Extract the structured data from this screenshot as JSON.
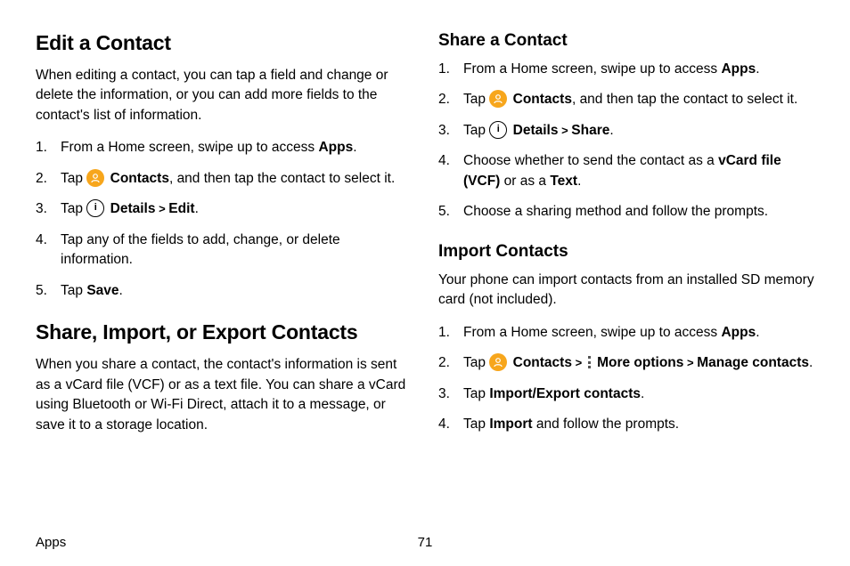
{
  "left": {
    "h_edit": "Edit a Contact",
    "p_edit": "When editing a contact, you can tap a field and change or delete the information, or you can add more fields to the contact's list of information.",
    "edit_list": {
      "i1a": "From a Home screen, swipe up to access ",
      "i1b": "Apps",
      "i1c": ".",
      "i2a": "Tap ",
      "i2b": "Contacts",
      "i2c": ", and then tap the contact to select it.",
      "i3a": "Tap ",
      "i3b": "Details",
      "i3chev": " > ",
      "i3d": "Edit",
      "i3e": ".",
      "i4": "Tap any of the fields to add, change, or delete information.",
      "i5a": "Tap ",
      "i5b": "Save",
      "i5c": "."
    },
    "h_share": "Share, Import, or Export Contacts",
    "p_share": "When you share a contact, the contact's information is sent as a vCard file (VCF) or as a text file. You can share a vCard using Bluetooth or Wi-Fi Direct, attach it to a message, or save it to a storage location."
  },
  "right": {
    "h_sharec": "Share a Contact",
    "share_list": {
      "i1a": "From a Home screen, swipe up to access ",
      "i1b": "Apps",
      "i1c": ".",
      "i2a": "Tap ",
      "i2b": "Contacts",
      "i2c": ", and then tap the contact to select it.",
      "i3a": "Tap ",
      "i3b": "Details",
      "i3chev": " > ",
      "i3d": "Share",
      "i3e": ".",
      "i4a": "Choose whether to send the contact as a ",
      "i4b": "vCard file (VCF)",
      "i4c": " or as a ",
      "i4d": "Text",
      "i4e": ".",
      "i5": "Choose a sharing method and follow the prompts."
    },
    "h_import": "Import Contacts",
    "p_import": "Your phone can import contacts from an installed SD memory card (not included).",
    "import_list": {
      "i1a": "From a Home screen, swipe up to access ",
      "i1b": "Apps",
      "i1c": ".",
      "i2a": "Tap ",
      "i2b": "Contacts",
      "i2chev1": " > ",
      "i2c": "More options",
      "i2chev2": " > ",
      "i2d": "Manage contacts",
      "i2e": ".",
      "i3a": "Tap ",
      "i3b": "Import/Export contacts",
      "i3c": ".",
      "i4a": "Tap ",
      "i4b": "Import",
      "i4c": " and follow the prompts."
    }
  },
  "footer": {
    "label": "Apps",
    "page": "71"
  },
  "icons": {
    "info_glyph": "i"
  }
}
